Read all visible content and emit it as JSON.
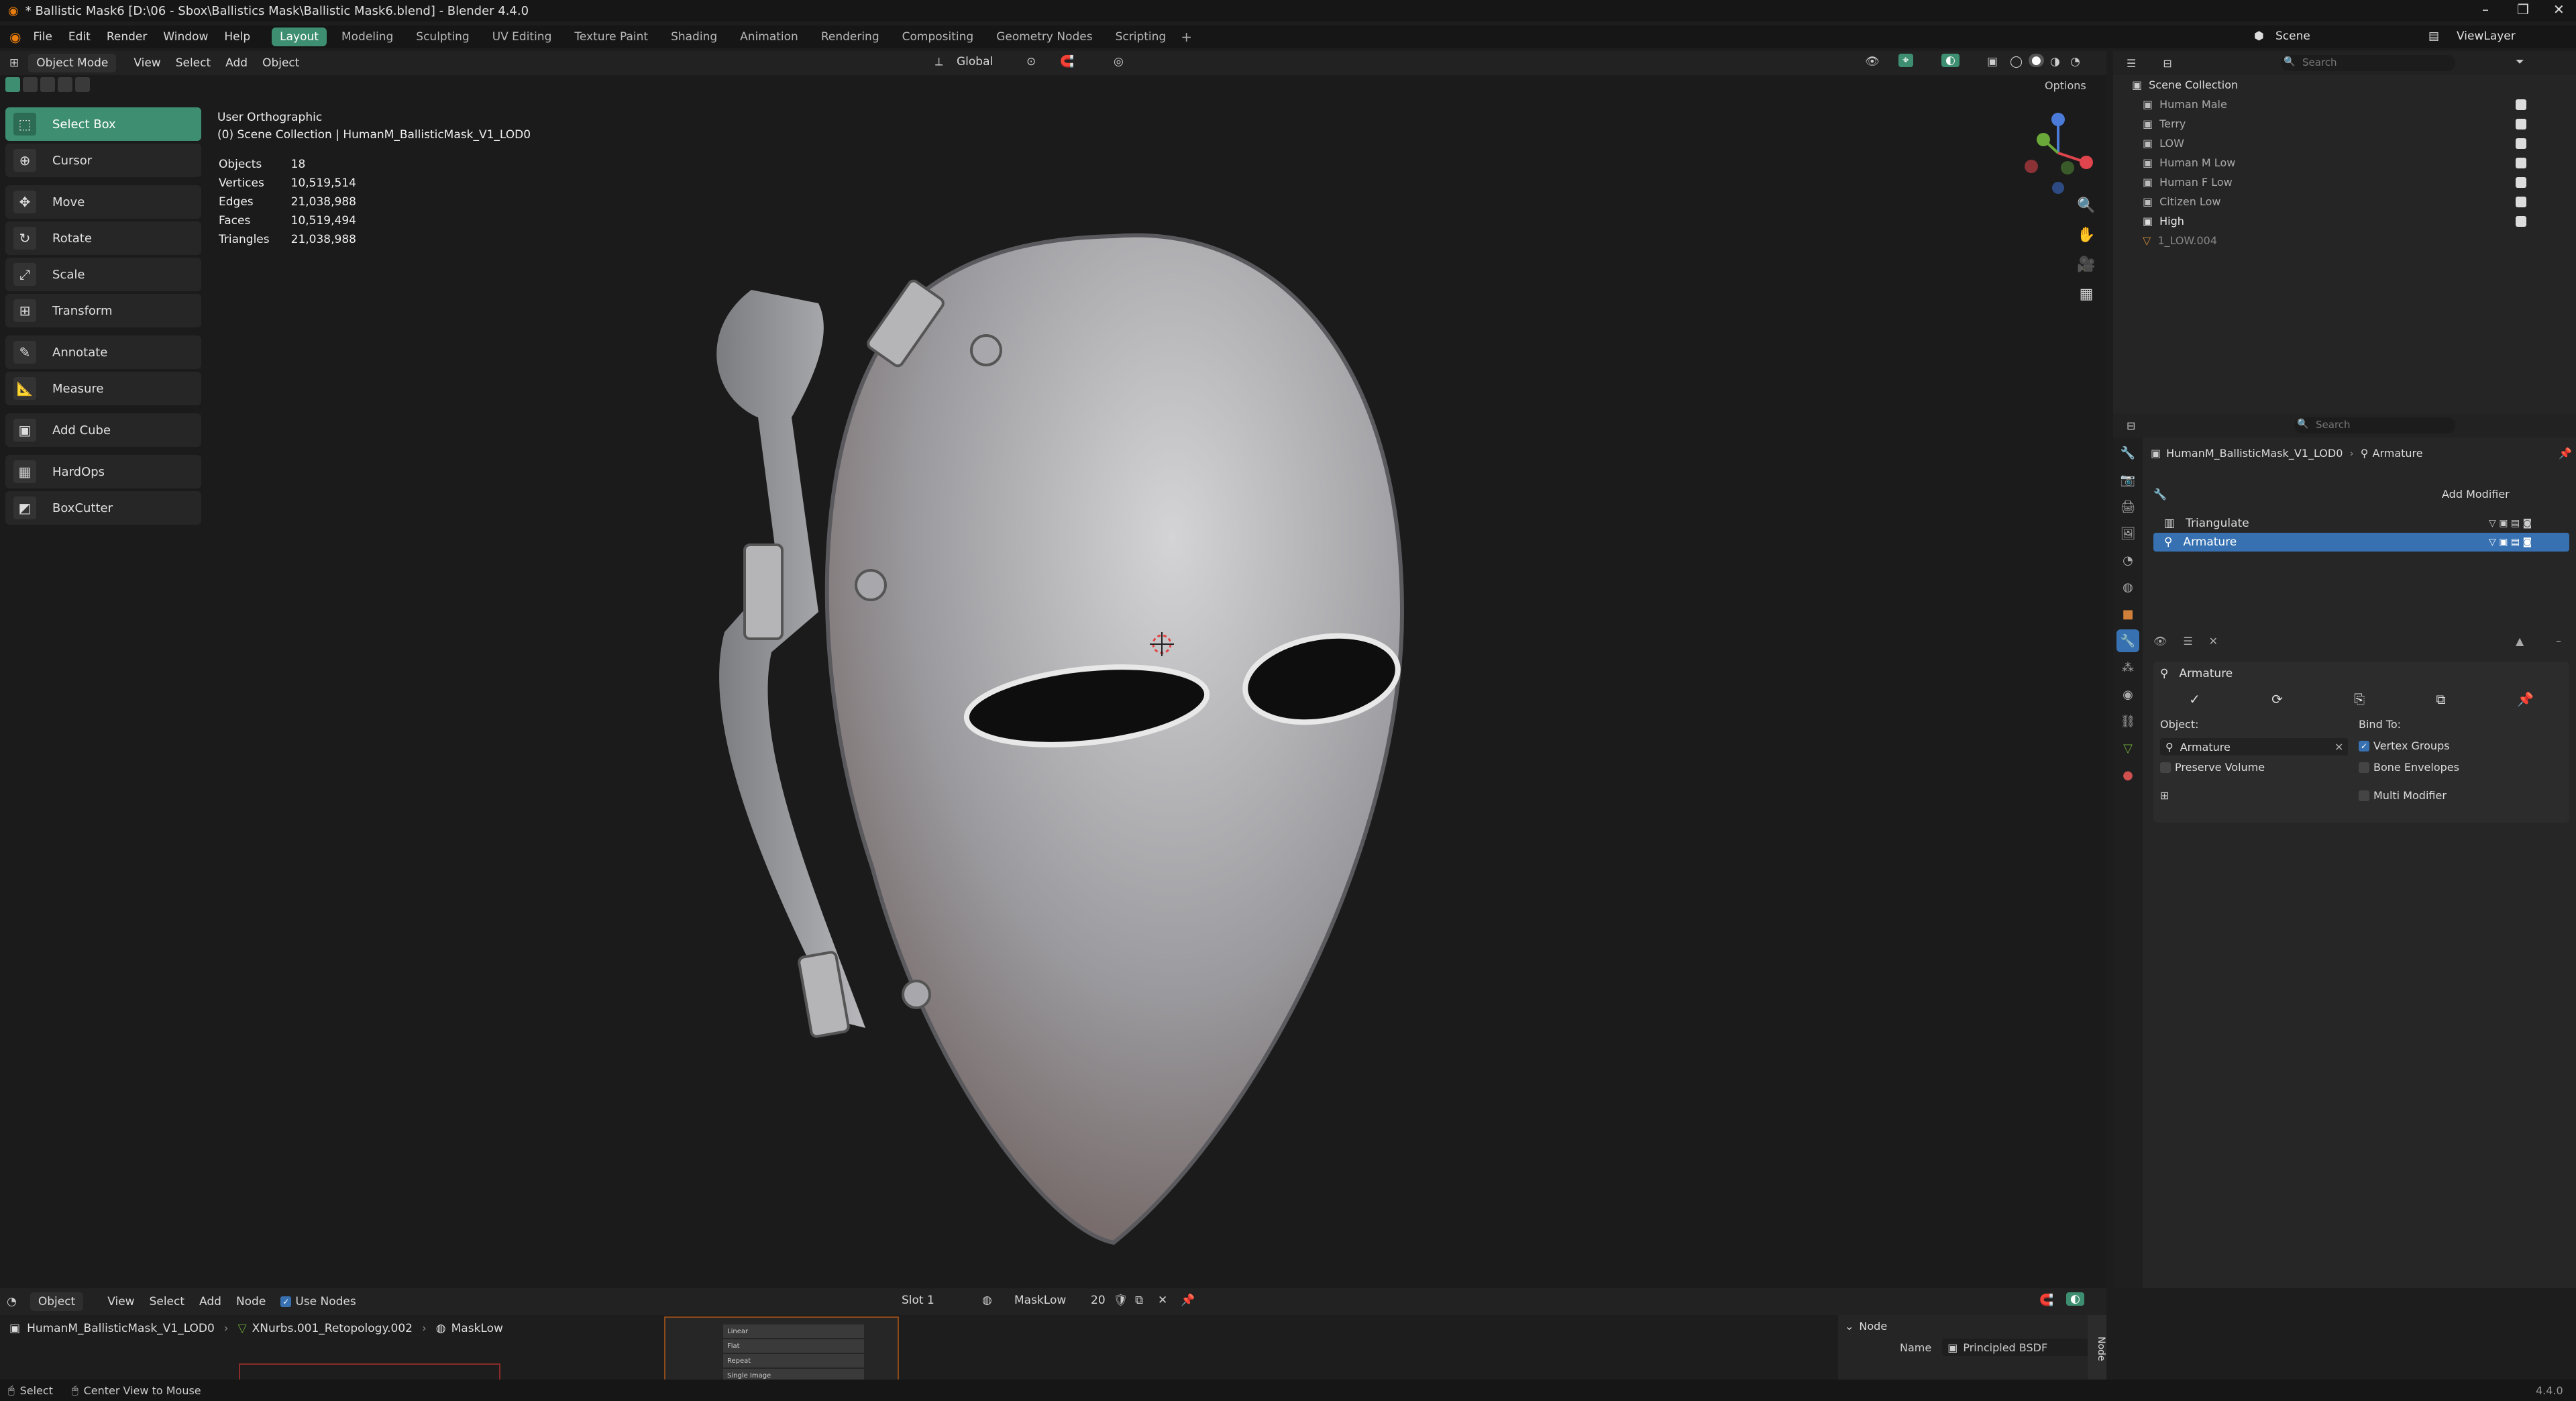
{
  "title": "* Ballistic Mask6 [D:\\06 - Sbox\\Ballistics Mask\\Ballistic Mask6.blend] - Blender 4.4.0",
  "menus": [
    "File",
    "Edit",
    "Render",
    "Window",
    "Help"
  ],
  "workspaces": [
    {
      "label": "Layout",
      "active": true
    },
    {
      "label": "Modeling"
    },
    {
      "label": "Sculpting"
    },
    {
      "label": "UV Editing"
    },
    {
      "label": "Texture Paint"
    },
    {
      "label": "Shading"
    },
    {
      "label": "Animation"
    },
    {
      "label": "Rendering"
    },
    {
      "label": "Compositing"
    },
    {
      "label": "Geometry Nodes"
    },
    {
      "label": "Scripting"
    }
  ],
  "scene_label": "Scene",
  "viewlayer_label": "ViewLayer",
  "viewport_header": {
    "mode": "Object Mode",
    "menus": [
      "View",
      "Select",
      "Add",
      "Object"
    ],
    "transform": "Global",
    "options": "Options"
  },
  "tools": [
    {
      "label": "Select Box",
      "icon": "select-box-icon",
      "glyph": "⬚",
      "active": true
    },
    {
      "label": "Cursor",
      "icon": "cursor-icon",
      "glyph": "⊕"
    },
    {
      "label": "Move",
      "icon": "move-icon",
      "glyph": "✥"
    },
    {
      "label": "Rotate",
      "icon": "rotate-icon",
      "glyph": "↻"
    },
    {
      "label": "Scale",
      "icon": "scale-icon",
      "glyph": "⤢"
    },
    {
      "label": "Transform",
      "icon": "transform-icon",
      "glyph": "⊞"
    },
    {
      "label": "Annotate",
      "icon": "annotate-icon",
      "glyph": "✎"
    },
    {
      "label": "Measure",
      "icon": "measure-icon",
      "glyph": "📐"
    },
    {
      "label": "Add Cube",
      "icon": "add-cube-icon",
      "glyph": "▣"
    },
    {
      "label": "HardOps",
      "icon": "hardops-icon",
      "glyph": "▦"
    },
    {
      "label": "BoxCutter",
      "icon": "boxcutter-icon",
      "glyph": "◩"
    }
  ],
  "overlay": {
    "view": "User Orthographic",
    "collection": "(0) Scene Collection | HumanM_BallisticMask_V1_LOD0"
  },
  "stats": [
    {
      "label": "Objects",
      "value": "18"
    },
    {
      "label": "Vertices",
      "value": "10,519,514"
    },
    {
      "label": "Edges",
      "value": "21,038,988"
    },
    {
      "label": "Faces",
      "value": "10,519,494"
    },
    {
      "label": "Triangles",
      "value": "21,038,988"
    }
  ],
  "outliner": {
    "search_placeholder": "Search",
    "root": "Scene Collection",
    "items": [
      {
        "label": "Human Male"
      },
      {
        "label": "Terry"
      },
      {
        "label": "LOW"
      },
      {
        "label": "Human M Low"
      },
      {
        "label": "Human F Low"
      },
      {
        "label": "Citizen Low"
      },
      {
        "label": "High",
        "bright": true
      },
      {
        "label": "1_LOW.004"
      }
    ]
  },
  "properties": {
    "search_placeholder": "Search",
    "object_path": "HumanM_BallisticMask_V1_LOD0",
    "modifier_path": "Armature",
    "add_modifier": "Add Modifier",
    "modifiers": [
      {
        "label": "Triangulate"
      },
      {
        "label": "Armature",
        "selected": true
      }
    ],
    "panel": {
      "title": "Armature",
      "object_label": "Object:",
      "object_value": "Armature",
      "preserve_volume": "Preserve Volume",
      "bind_to": "Bind To:",
      "vertex_groups": "Vertex Groups",
      "bone_envelopes": "Bone Envelopes",
      "multi_modifier": "Multi Modifier"
    }
  },
  "node_editor": {
    "mode": "Object",
    "menus": [
      "View",
      "Select",
      "Add",
      "Node"
    ],
    "use_nodes": "Use Nodes",
    "slot": "Slot 1",
    "material": "MaskLow",
    "users": "20",
    "breadcrumb": [
      "HumanM_BallisticMask_V1_LOD0",
      "XNurbs.001_Retopology.002",
      "MaskLow"
    ],
    "node_items": [
      "Linear",
      "Flat",
      "Repeat",
      "Single Image"
    ],
    "sidebar_section": "Node",
    "name_label": "Name",
    "name_value": "Principled BSDF",
    "sidebar_tab": "Node"
  },
  "status": {
    "left": "Select",
    "mid": "Center View to Mouse",
    "version": "4.4.0"
  },
  "colors": {
    "accent": "#3e8f72",
    "selection": "#3771b2",
    "axis_x": "#e0444c",
    "axis_y": "#6ba83a",
    "axis_z": "#4a7bd8"
  }
}
